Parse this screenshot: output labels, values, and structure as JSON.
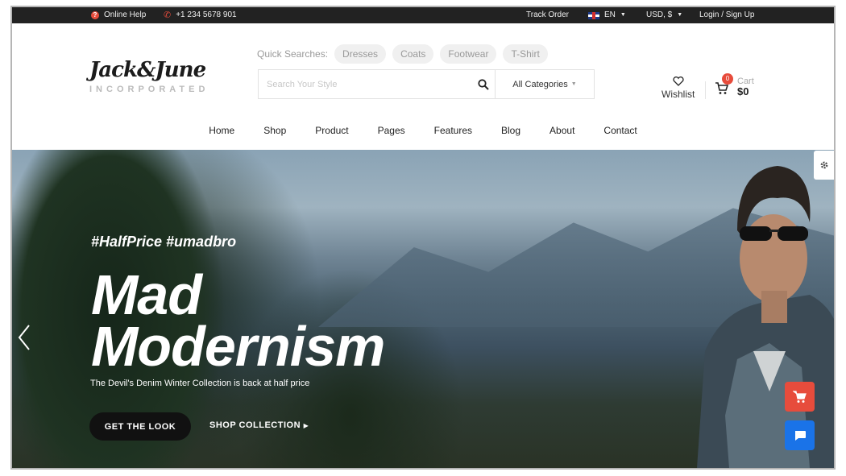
{
  "topbar": {
    "help": "Online Help",
    "phone": "+1 234 5678 901",
    "track_order": "Track Order",
    "language": "EN",
    "currency": "USD, $",
    "login": "Login / Sign Up"
  },
  "logo": {
    "script": "Jack&June",
    "sub": "INCORPORATED"
  },
  "quick_searches": {
    "label": "Quick Searches:",
    "items": [
      "Dresses",
      "Coats",
      "Footwear",
      "T-Shirt"
    ]
  },
  "search": {
    "placeholder": "Search Your Style",
    "category": "All Categories"
  },
  "wishlist": {
    "label": "Wishlist"
  },
  "cart": {
    "count": "0",
    "label": "Cart",
    "total": "$0"
  },
  "nav": [
    "Home",
    "Shop",
    "Product",
    "Pages",
    "Features",
    "Blog",
    "About",
    "Contact"
  ],
  "hero": {
    "hashtag": "#HalfPrice #umadbro",
    "line1": "Mad",
    "line2": "Modernism",
    "subtitle": "The Devil's Denim Winter Collection is back at half price",
    "cta_primary": "GET THE LOOK",
    "cta_secondary": "SHOP COLLECTION"
  },
  "colors": {
    "accent": "#e74c3c",
    "chat": "#1a73e8",
    "topbar": "#222222"
  },
  "icons": [
    "help-icon",
    "phone-icon",
    "uk-flag-icon",
    "search-icon",
    "heart-icon",
    "cart-icon",
    "gear-icon",
    "chat-icon",
    "chevron-left-icon"
  ]
}
